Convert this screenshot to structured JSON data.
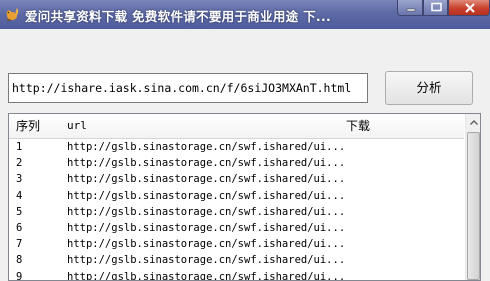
{
  "window": {
    "title": "爱问共享资料下载 免费软件请不要用于商业用途 下..."
  },
  "form": {
    "url_value": "http://ishare.iask.sina.com.cn/f/6siJO3MXAnT.html",
    "analyze_label": "分析"
  },
  "list": {
    "columns": [
      "序列",
      "url",
      "下载"
    ],
    "rows": [
      {
        "index": "1",
        "url": "http://gslb.sinastorage.cn/swf.ishared/ui..."
      },
      {
        "index": "2",
        "url": "http://gslb.sinastorage.cn/swf.ishared/ui..."
      },
      {
        "index": "3",
        "url": "http://gslb.sinastorage.cn/swf.ishared/ui..."
      },
      {
        "index": "4",
        "url": "http://gslb.sinastorage.cn/swf.ishared/ui..."
      },
      {
        "index": "5",
        "url": "http://gslb.sinastorage.cn/swf.ishared/ui..."
      },
      {
        "index": "6",
        "url": "http://gslb.sinastorage.cn/swf.ishared/ui..."
      },
      {
        "index": "7",
        "url": "http://gslb.sinastorage.cn/swf.ishared/ui..."
      },
      {
        "index": "8",
        "url": "http://gslb.sinastorage.cn/swf.ishared/ui..."
      },
      {
        "index": "9",
        "url": "http://gslb.sinastorage.cn/swf.ishared/ui..."
      }
    ]
  },
  "icons": {
    "app": "squirrel-icon",
    "minimize": "minimize-icon",
    "maximize": "maximize-icon",
    "close": "close-icon"
  },
  "colors": {
    "titlebar": "#5d6aa6",
    "close_button": "#c8402c"
  }
}
